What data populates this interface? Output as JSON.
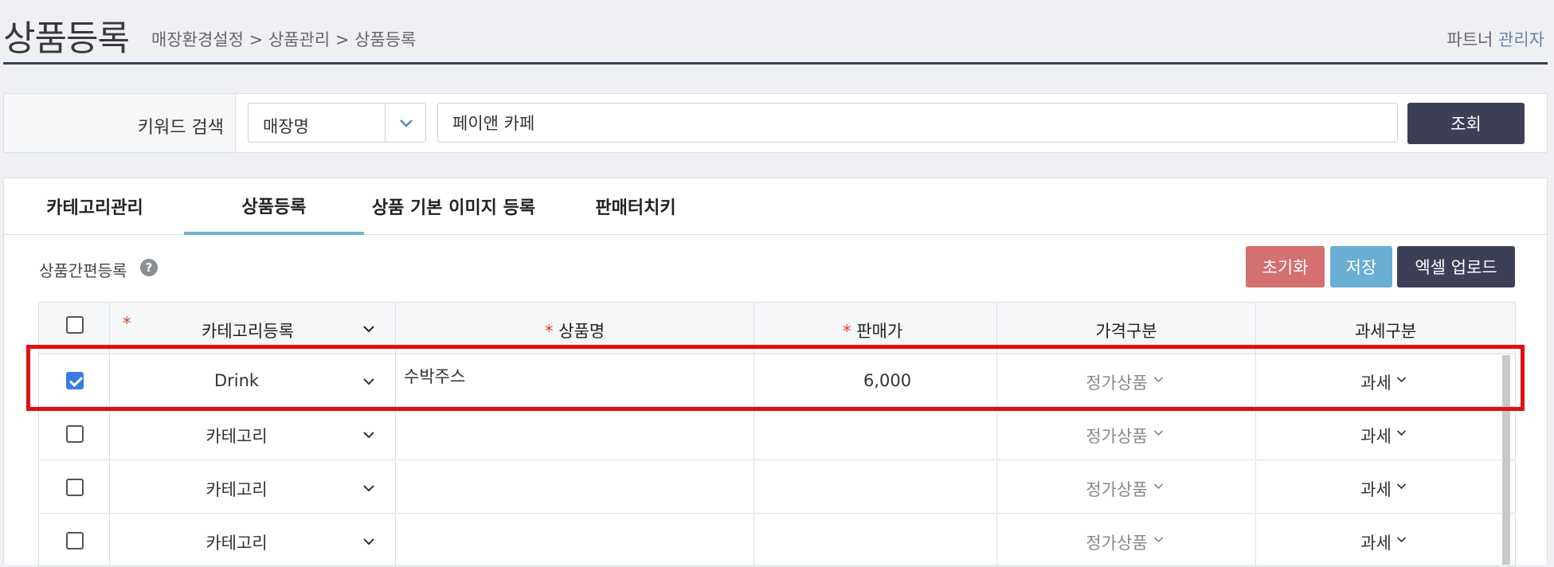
{
  "header": {
    "title": "상품등록",
    "breadcrumb": "매장환경설정 > 상품관리 > 상품등록",
    "user_prefix": "파트너",
    "user_role": "관리자"
  },
  "search": {
    "label": "키워드 검색",
    "select_value": "매장명",
    "keyword_value": "페이앤 카페",
    "button_label": "조회"
  },
  "tabs": [
    {
      "label": "카테고리관리"
    },
    {
      "label": "상품등록"
    },
    {
      "label": "상품 기본 이미지 등록"
    },
    {
      "label": "판매터치키"
    }
  ],
  "active_tab": "상품등록",
  "section": {
    "title": "상품간편등록",
    "help": "?"
  },
  "actions": {
    "reset": "초기화",
    "save": "저장",
    "excel": "엑셀 업로드"
  },
  "table": {
    "headers": {
      "category": "카테고리등록",
      "name": "상품명",
      "price": "판매가",
      "price_type": "가격구분",
      "tax_type": "과세구분",
      "required_mark": "*"
    },
    "rows": [
      {
        "checked": true,
        "category": "Drink",
        "name": "수박주스",
        "price": "6,000",
        "price_type": "정가상품",
        "tax_type": "과세"
      },
      {
        "checked": false,
        "category": "카테고리",
        "name": "",
        "price": "",
        "price_type": "정가상품",
        "tax_type": "과세"
      },
      {
        "checked": false,
        "category": "카테고리",
        "name": "",
        "price": "",
        "price_type": "정가상품",
        "tax_type": "과세"
      },
      {
        "checked": false,
        "category": "카테고리",
        "name": "",
        "price": "",
        "price_type": "정가상품",
        "tax_type": "과세"
      }
    ]
  },
  "colors": {
    "accent_tab": "#6fb5cf",
    "dark_button": "#3d3f55",
    "reset_button": "#d47070",
    "save_button": "#6aaed4",
    "highlight": "#e01010",
    "checkbox": "#3b7be0"
  }
}
